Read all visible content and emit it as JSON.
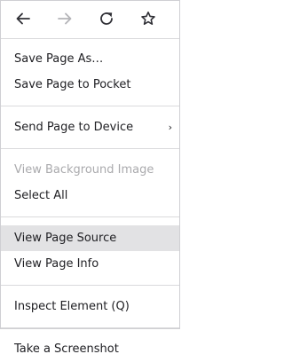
{
  "navbar": {
    "back_icon": "arrow-left-icon",
    "forward_icon": "arrow-right-icon",
    "reload_icon": "reload-icon",
    "bookmark_icon": "star-icon"
  },
  "items": {
    "save_page_as": "Save Page As…",
    "save_to_pocket": "Save Page to Pocket",
    "send_to_device": "Send Page to Device",
    "submenu_arrow": "›",
    "view_background": "View Background Image",
    "select_all": "Select All",
    "view_source": "View Page Source",
    "view_info": "View Page Info",
    "inspect": "Inspect Element (Q)",
    "screenshot": "Take a Screenshot"
  },
  "colors": {
    "text": "#202024",
    "disabled_text": "#aaaaad",
    "hover_bg": "#e2e2e4",
    "forward_disabled": "#b4b4b8"
  }
}
